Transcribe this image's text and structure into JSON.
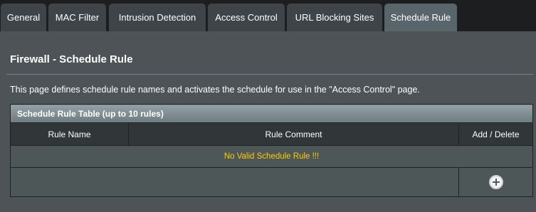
{
  "tabs": [
    {
      "label": "General"
    },
    {
      "label": "MAC Filter"
    },
    {
      "label": "Intrusion Detection"
    },
    {
      "label": "Access Control"
    },
    {
      "label": "URL Blocking Sites"
    },
    {
      "label": "Schedule Rule",
      "active": true
    }
  ],
  "page": {
    "title": "Firewall - Schedule Rule",
    "description": "This page defines schedule rule names and activates the schedule for use in the \"Access Control\" page."
  },
  "table": {
    "caption": "Schedule Rule Table (up to 10 rules)",
    "columns": [
      "Rule Name",
      "Rule Comment",
      "Add / Delete"
    ],
    "empty_message": "No Valid Schedule Rule !!!",
    "add_icon": "plus-circle-icon"
  },
  "colors": {
    "panel_bg": "#4d5356",
    "tab_active": "#58666b",
    "tab_inactive": "#3e4447",
    "warning_text": "#ffcc00"
  }
}
